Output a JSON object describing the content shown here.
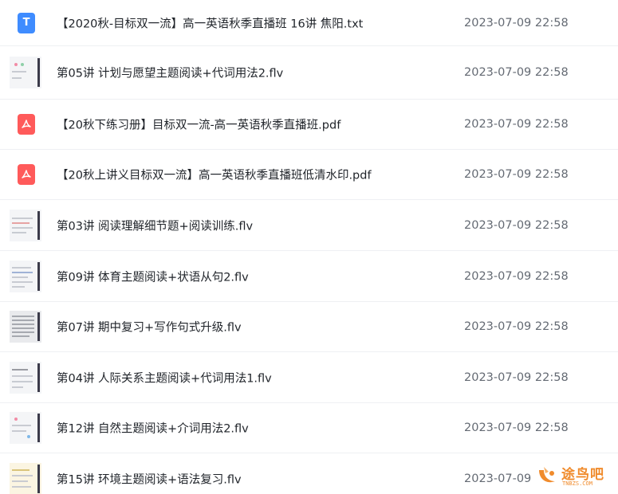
{
  "files": [
    {
      "type": "txt",
      "name": "【2020秋-目标双一流】高一英语秋季直播班 16讲 焦阳.txt",
      "date": "2023-07-09 22:58"
    },
    {
      "type": "video",
      "name": "第05讲 计划与愿望主题阅读+代词用法2.flv",
      "date": "2023-07-09 22:58"
    },
    {
      "type": "pdf",
      "name": "【20秋下练习册】目标双一流-高一英语秋季直播班.pdf",
      "date": "2023-07-09 22:58"
    },
    {
      "type": "pdf",
      "name": "【20秋上讲义目标双一流】高一英语秋季直播班低清水印.pdf",
      "date": "2023-07-09 22:58"
    },
    {
      "type": "video",
      "name": "第03讲 阅读理解细节题+阅读训练.flv",
      "date": "2023-07-09 22:58"
    },
    {
      "type": "video",
      "name": "第09讲 体育主题阅读+状语从句2.flv",
      "date": "2023-07-09 22:58"
    },
    {
      "type": "video",
      "name": "第07讲 期中复习+写作句式升级.flv",
      "date": "2023-07-09 22:58"
    },
    {
      "type": "video",
      "name": "第04讲 人际关系主题阅读+代词用法1.flv",
      "date": "2023-07-09 22:58"
    },
    {
      "type": "video",
      "name": "第12讲 自然主题阅读+介词用法2.flv",
      "date": "2023-07-09 22:58"
    },
    {
      "type": "video",
      "name": "第15讲 环境主题阅读+语法复习.flv",
      "date": "2023-07-09"
    }
  ],
  "icons": {
    "txt": "txt-file-icon",
    "pdf": "pdf-file-icon",
    "video": "video-thumbnail"
  },
  "icon_glyphs": {
    "txt": "T"
  },
  "colors": {
    "txt": "#3f8cff",
    "pdf": "#ff5a5a",
    "watermark": "#f08b2c"
  },
  "watermark": {
    "text": "途鸟吧",
    "sub": "TNBZS.COM"
  }
}
